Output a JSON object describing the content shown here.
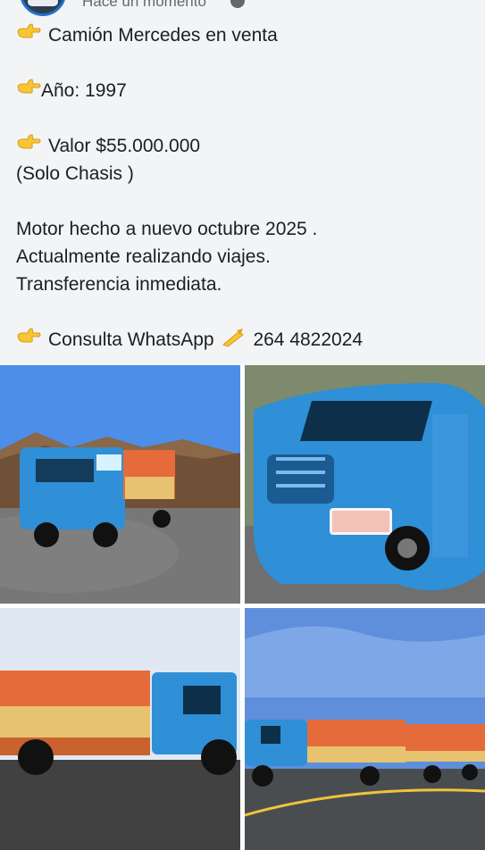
{
  "post": {
    "timestamp": "Hace un momento",
    "lines": {
      "title": "Camión Mercedes en venta",
      "year": "Año: 1997",
      "price": "Valor $55.000.000",
      "chassis": "(Solo Chasis )",
      "motor": "Motor hecho a nuevo octubre 2025 .",
      "travel": "Actualmente realizando viajes.",
      "transfer": "Transferencia inmediata.",
      "contact_prefix": "Consulta WhatsApp",
      "contact_phone": "264 4822024"
    },
    "icons": {
      "pointing": "backhand-index-pointing-right-emoji",
      "writing": "writing-hand-emoji",
      "privacy": "globe-icon"
    }
  },
  "photos": [
    {
      "name": "Blue Mercedes truck with orange load in desert road"
    },
    {
      "name": "Close-up front of blue Mercedes truck"
    },
    {
      "name": "Blue truck side view with orange tarp"
    },
    {
      "name": "Blue truck with trailer on highway"
    }
  ],
  "colors": {
    "truck_blue": "#2f8fd7",
    "tarp_orange": "#e56b3b",
    "cargo_yellow": "#e7c36f",
    "text": "#1c1e21",
    "muted": "#65676b"
  }
}
